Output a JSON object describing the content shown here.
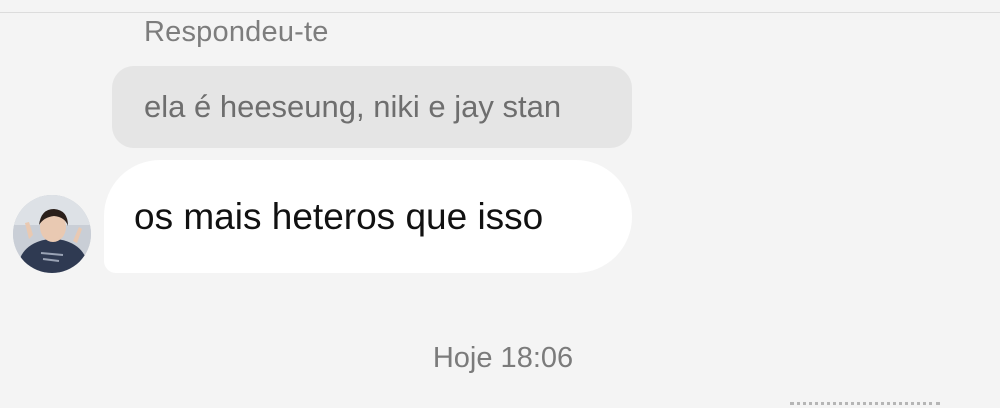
{
  "reply": {
    "header": "Respondeu-te",
    "quoted_text": "ela é heeseung, niki e jay stan"
  },
  "message": {
    "text": "os mais heteros que isso",
    "avatar_icon": "user-avatar-icon"
  },
  "timestamp": "Hoje 18:06",
  "colors": {
    "background": "#f4f4f4",
    "quoted_bubble": "#e5e5e5",
    "message_bubble": "#ffffff"
  }
}
